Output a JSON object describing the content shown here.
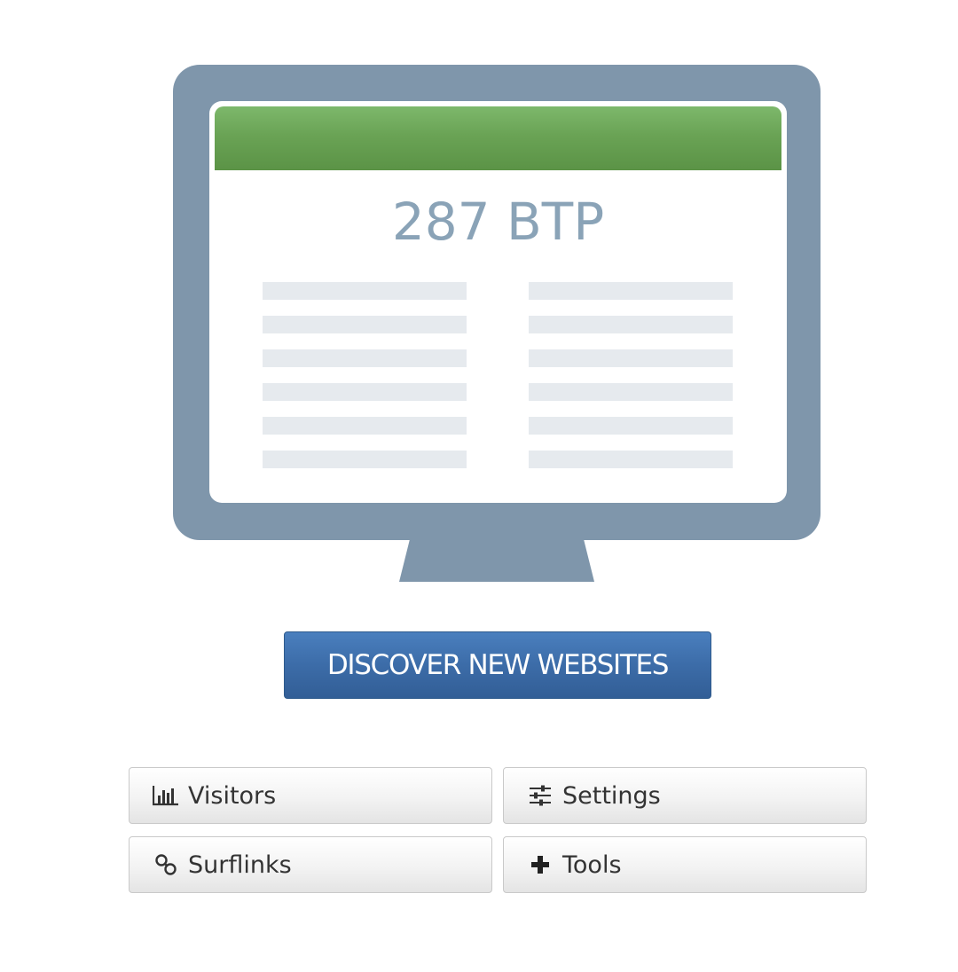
{
  "monitor": {
    "balance_text": "287 BTP"
  },
  "discover_button": {
    "label": "DISCOVER NEW WEBSITES"
  },
  "actions": [
    {
      "label": "Visitors",
      "icon": "bar-chart-icon"
    },
    {
      "label": "Settings",
      "icon": "sliders-icon"
    },
    {
      "label": "Surflinks",
      "icon": "link-icon"
    },
    {
      "label": "Tools",
      "icon": "plus-icon"
    }
  ],
  "colors": {
    "monitor_frame": "#7f96ab",
    "screen_header_green": "#6aa355",
    "balance_text": "#8aa3b7",
    "discover_button": "#3c6ca8",
    "placeholder_lines": "#e6eaee"
  }
}
